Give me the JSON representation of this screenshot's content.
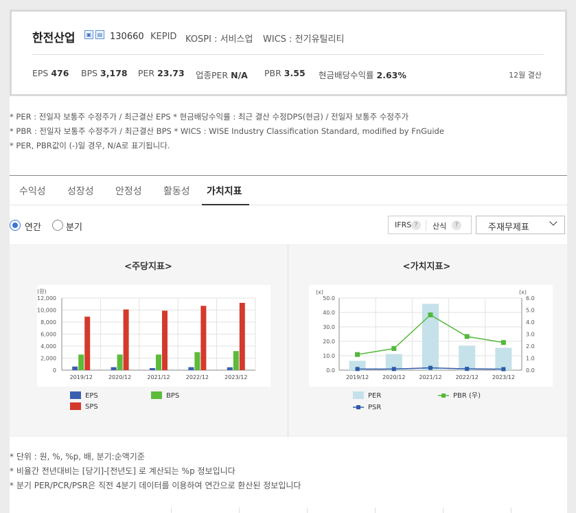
{
  "company": {
    "name": "한전산업",
    "code": "130660",
    "alias": "KEPID",
    "market": "KOSPI : 서비스업",
    "wics": "WICS : 전기유틸리티",
    "icons": [
      "building-icon",
      "document-icon"
    ]
  },
  "metrics": [
    {
      "label": "EPS",
      "value": "476"
    },
    {
      "label": "BPS",
      "value": "3,178"
    },
    {
      "label": "PER",
      "value": "23.73"
    },
    {
      "label": "업종PER",
      "value": "N/A"
    },
    {
      "label": "PBR",
      "value": "3.55"
    },
    {
      "label": "현금배당수익률",
      "value": "2.63%"
    }
  ],
  "fiscal_close": "12월 결산",
  "notes": [
    "* PER : 전일자 보통주 수정주가 / 최근결산 EPS * 현금배당수익률 : 최근 결산 수정DPS(현금) / 전일자 보통주 수정주가",
    "* PBR : 전일자 보통주 수정주가 / 최근결산 BPS * WICS : WISE Industry Classification Standard, modified by FnGuide",
    "* PER, PBR값이 (-)일 경우, N/A로 표기됩니다."
  ],
  "tabs": [
    {
      "label": "수익성",
      "active": false
    },
    {
      "label": "성장성",
      "active": false
    },
    {
      "label": "안정성",
      "active": false
    },
    {
      "label": "활동성",
      "active": false
    },
    {
      "label": "가치지표",
      "active": true
    }
  ],
  "period_options": [
    {
      "label": "연간",
      "selected": true
    },
    {
      "label": "분기",
      "selected": false
    }
  ],
  "toggles": {
    "ifrs": "IFRS",
    "calc": "산식",
    "help": "?"
  },
  "statement_select": "주재무제표",
  "colors": {
    "eps": "#3a5fb0",
    "bps": "#5dbb3a",
    "sps": "#d43a2c",
    "per": "#c5e1ea",
    "pbr": "#54b83a",
    "psr": "#2d5aa8",
    "accent": "#3b75d6"
  },
  "chart_data": [
    {
      "type": "bar",
      "title": "<주당지표>",
      "unit_label": "(원)",
      "categories": [
        "2019/12",
        "2020/12",
        "2021/12",
        "2022/12",
        "2023/12"
      ],
      "series": [
        {
          "name": "EPS",
          "values": [
            600,
            500,
            350,
            500,
            476
          ]
        },
        {
          "name": "BPS",
          "values": [
            2600,
            2600,
            2600,
            3000,
            3178
          ]
        },
        {
          "name": "SPS",
          "values": [
            8900,
            10100,
            9900,
            10700,
            11200
          ]
        }
      ],
      "ylim": [
        0,
        12000
      ],
      "yticks": [
        "0",
        "2,000",
        "4,000",
        "6,000",
        "8,000",
        "10,000",
        "12,000"
      ],
      "legend": "bottom"
    },
    {
      "type": "bar+line",
      "title": "<가치지표>",
      "unit_label_left": "(x)",
      "unit_label_right": "(x)",
      "categories": [
        "2019/12",
        "2020/12",
        "2021/12",
        "2022/12",
        "2023/12"
      ],
      "series": [
        {
          "name": "PER",
          "type": "bar",
          "axis": "left",
          "values": [
            6.5,
            11.2,
            46.0,
            17.0,
            15.5
          ]
        },
        {
          "name": "PBR (우)",
          "type": "line",
          "axis": "right",
          "values": [
            1.3,
            1.8,
            4.6,
            2.8,
            2.3
          ]
        },
        {
          "name": "PSR",
          "type": "line",
          "axis": "left",
          "values": [
            0.8,
            0.8,
            1.6,
            0.9,
            0.7
          ]
        }
      ],
      "ylim_left": [
        0,
        50
      ],
      "yticks_left": [
        "0.0",
        "10.0",
        "20.0",
        "30.0",
        "40.0",
        "50.0"
      ],
      "ylim_right": [
        0,
        6
      ],
      "yticks_right": [
        "0.0",
        "1.0",
        "2.0",
        "3.0",
        "4.0",
        "5.0",
        "6.0"
      ],
      "legend": "bottom"
    }
  ],
  "footnotes": [
    "* 단위 : 원, %, %p, 배, 분기:순액기준",
    "* 비율간 전년대비는 [당기]-[전년도] 로 계산되는 %p 정보입니다",
    "* 분기 PER/PCR/PSR은 직전 4분기 데이터를 이용하여 연간으로 환산된 정보입니다"
  ]
}
